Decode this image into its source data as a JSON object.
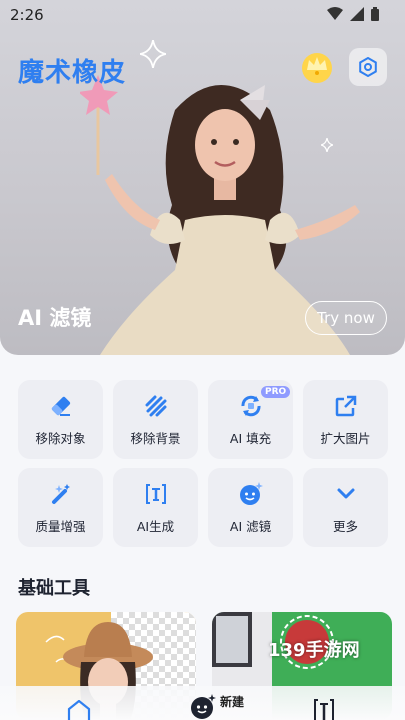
{
  "status_bar": {
    "time": "2:26"
  },
  "hero": {
    "app_title": "魔术橡皮",
    "filter_label": "AI 滤镜",
    "try_button": "Try now"
  },
  "tools": [
    {
      "label": "移除对象",
      "icon": "eraser-icon"
    },
    {
      "label": "移除背景",
      "icon": "stripes-icon"
    },
    {
      "label": "AI 填充",
      "icon": "refresh-fill-icon",
      "badge": "PRO"
    },
    {
      "label": "扩大图片",
      "icon": "expand-icon"
    },
    {
      "label": "质量增强",
      "icon": "magic-wand-icon"
    },
    {
      "label": "AI生成",
      "icon": "text-cursor-icon"
    },
    {
      "label": "AI 滤镜",
      "icon": "face-sparkle-icon"
    },
    {
      "label": "更多",
      "icon": "chevron-down-icon"
    }
  ],
  "section": {
    "title": "基础工具"
  },
  "watermark": "139手游网",
  "bottom_nav": {
    "new_label": "新建"
  },
  "colors": {
    "accent": "#2f7ff0",
    "tile_bg": "#edeef3",
    "pro_badge": "#8f9bff"
  }
}
